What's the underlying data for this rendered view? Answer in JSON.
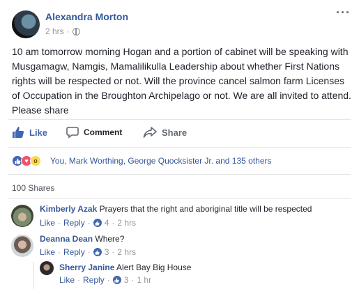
{
  "post": {
    "author": "Alexandra Morton",
    "time": "2 hrs",
    "separator": "·",
    "more": "···",
    "text": "10 am tomorrow morning Hogan and a portion of cabinet will be speaking with Musgamagw, Namgis, Mamalilikulla Leadership about whether First Nations rights will be respected or not. Will the province cancel salmon farm Licenses of Occupation in the Broughton Archipelago or not. We are all invited to attend. Please share"
  },
  "actions": {
    "like": "Like",
    "comment": "Comment",
    "share": "Share"
  },
  "reactions": {
    "icons": [
      "like-reaction",
      "love-reaction",
      "wow-reaction"
    ],
    "summary": "You, Mark Worthing, George Quocksister Jr. and 135 others"
  },
  "shares": "100 Shares",
  "comments": [
    {
      "name": "Kimberly Azak",
      "text": "Prayers that the right and aboriginal title will be respected",
      "like": "Like",
      "reply": "Reply",
      "count": "4",
      "time": "2 hrs"
    },
    {
      "name": "Deanna Dean",
      "text": "Where?",
      "like": "Like",
      "reply": "Reply",
      "count": "3",
      "time": "2 hrs"
    },
    {
      "name": "Sherry Janine",
      "text": "Alert Bay Big House",
      "like": "Like",
      "reply": "Reply",
      "count": "3",
      "time": "1 hr"
    }
  ],
  "colors": {
    "link": "#365899",
    "brand": "#4267b2",
    "muted": "#90949c"
  }
}
